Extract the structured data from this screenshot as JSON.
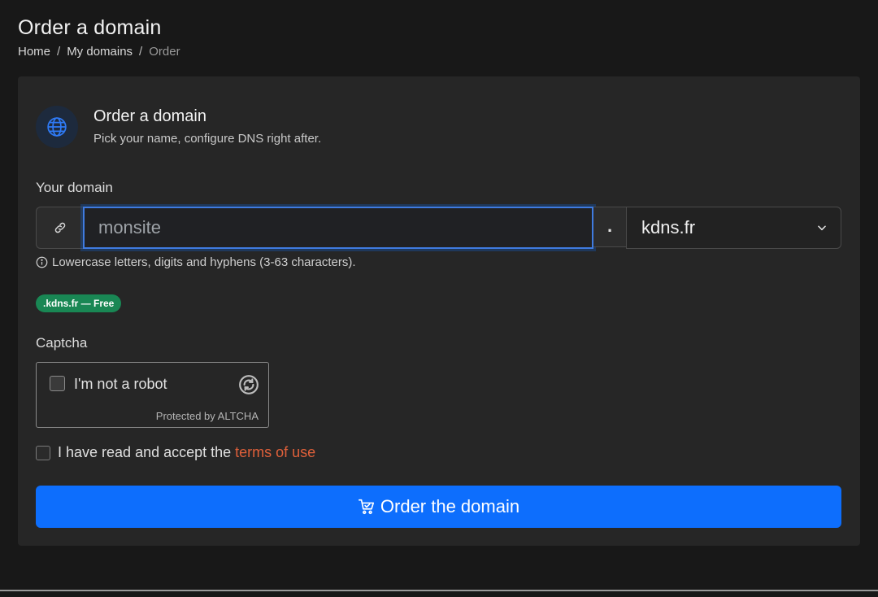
{
  "page": {
    "title": "Order a domain",
    "breadcrumb": [
      "Home",
      "My domains",
      "Order"
    ],
    "breadcrumb_separator": "/"
  },
  "card": {
    "title": "Order a domain",
    "subtitle": "Pick your name, configure DNS right after.",
    "icon": "globe-icon"
  },
  "domain_field": {
    "label": "Your domain",
    "value": "monsite",
    "dot": ".",
    "tld_selected": "kdns.fr",
    "help": "Lowercase letters, digits and hyphens (3-63 characters).",
    "badge": ".kdns.fr — Free"
  },
  "captcha": {
    "label": "Captcha",
    "checkbox_label": "I'm not a robot",
    "footer": "Protected by ALTCHA"
  },
  "terms": {
    "text": "I have read and accept the",
    "link": "terms of use"
  },
  "submit": {
    "label": "Order the domain"
  },
  "colors": {
    "accent": "#0d6efd",
    "badge": "#198754",
    "link": "#e0603a"
  }
}
